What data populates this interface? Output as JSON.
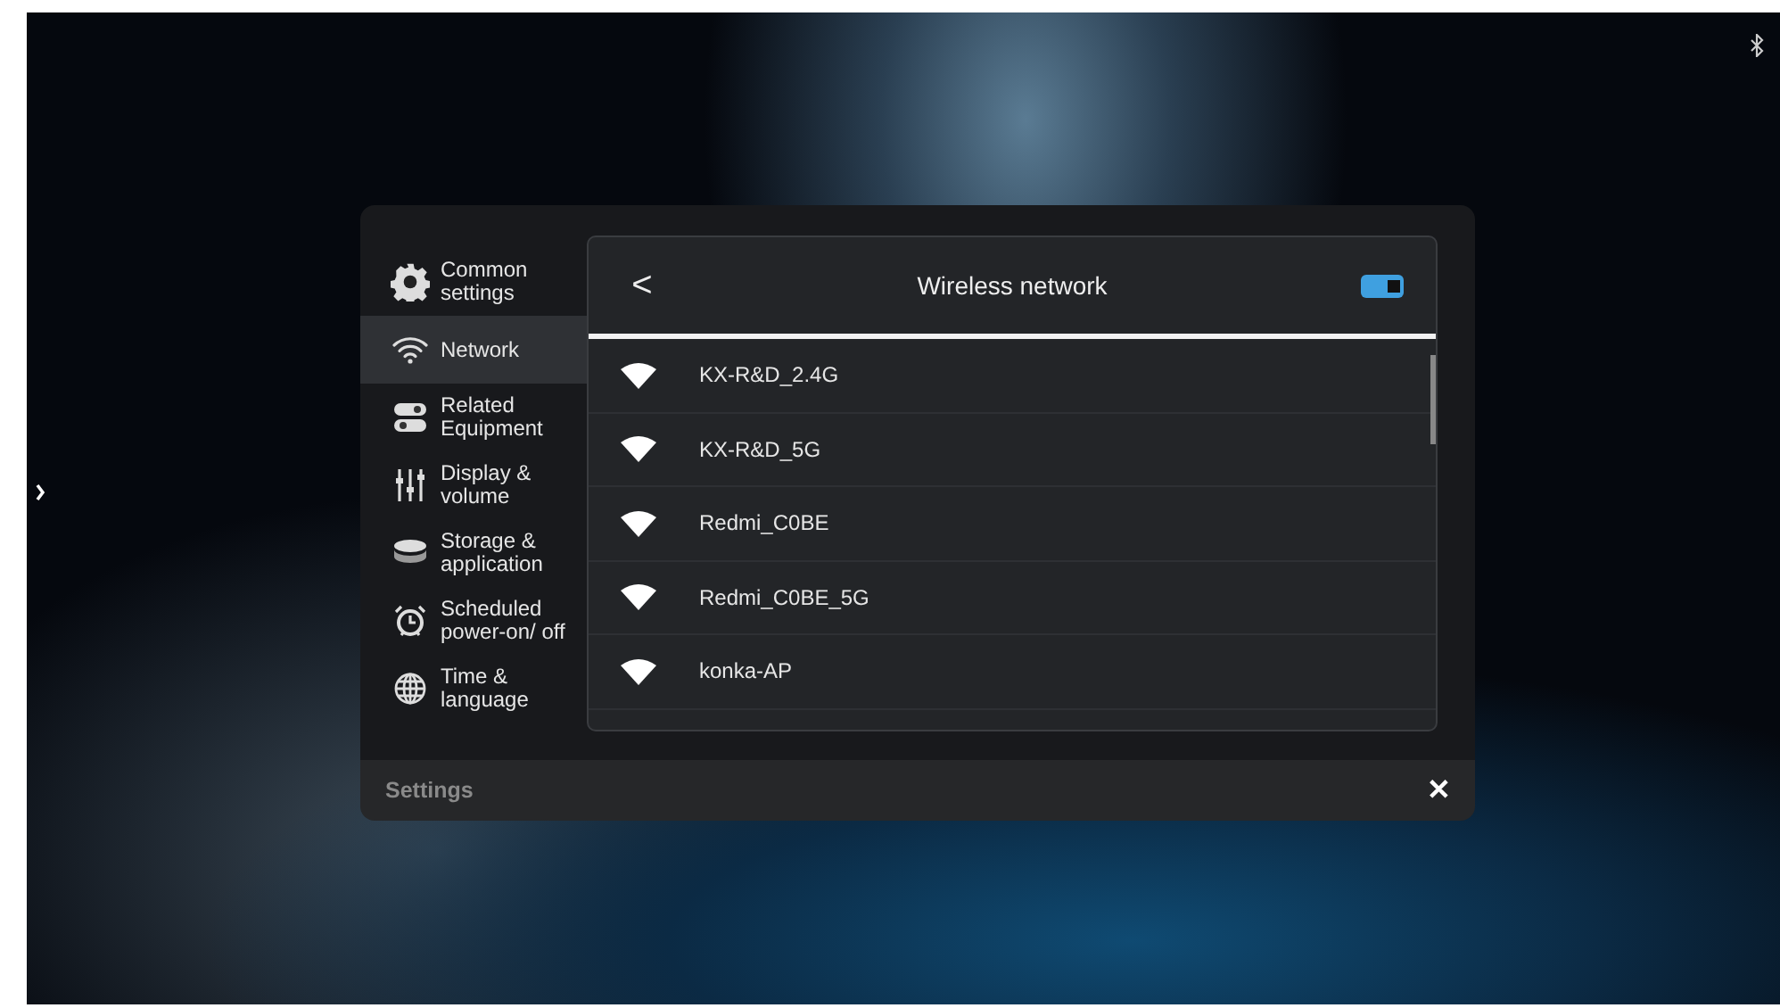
{
  "sidebar": {
    "items": [
      {
        "label": "Common settings",
        "selected": false
      },
      {
        "label": "Network",
        "selected": true
      },
      {
        "label": "Related Equipment",
        "selected": false
      },
      {
        "label": "Display & volume",
        "selected": false
      },
      {
        "label": "Storage & application",
        "selected": false
      },
      {
        "label": "Scheduled power-on/ off",
        "selected": false
      },
      {
        "label": "Time & language",
        "selected": false
      }
    ]
  },
  "panel": {
    "back": "<",
    "title": "Wireless network",
    "toggle": {
      "on": true
    },
    "networks": [
      {
        "name": "KX-R&D_2.4G"
      },
      {
        "name": "KX-R&D_5G"
      },
      {
        "name": "Redmi_C0BE"
      },
      {
        "name": "Redmi_C0BE_5G"
      },
      {
        "name": "konka-AP"
      }
    ]
  },
  "footer": {
    "title": "Settings",
    "close": "✕"
  }
}
